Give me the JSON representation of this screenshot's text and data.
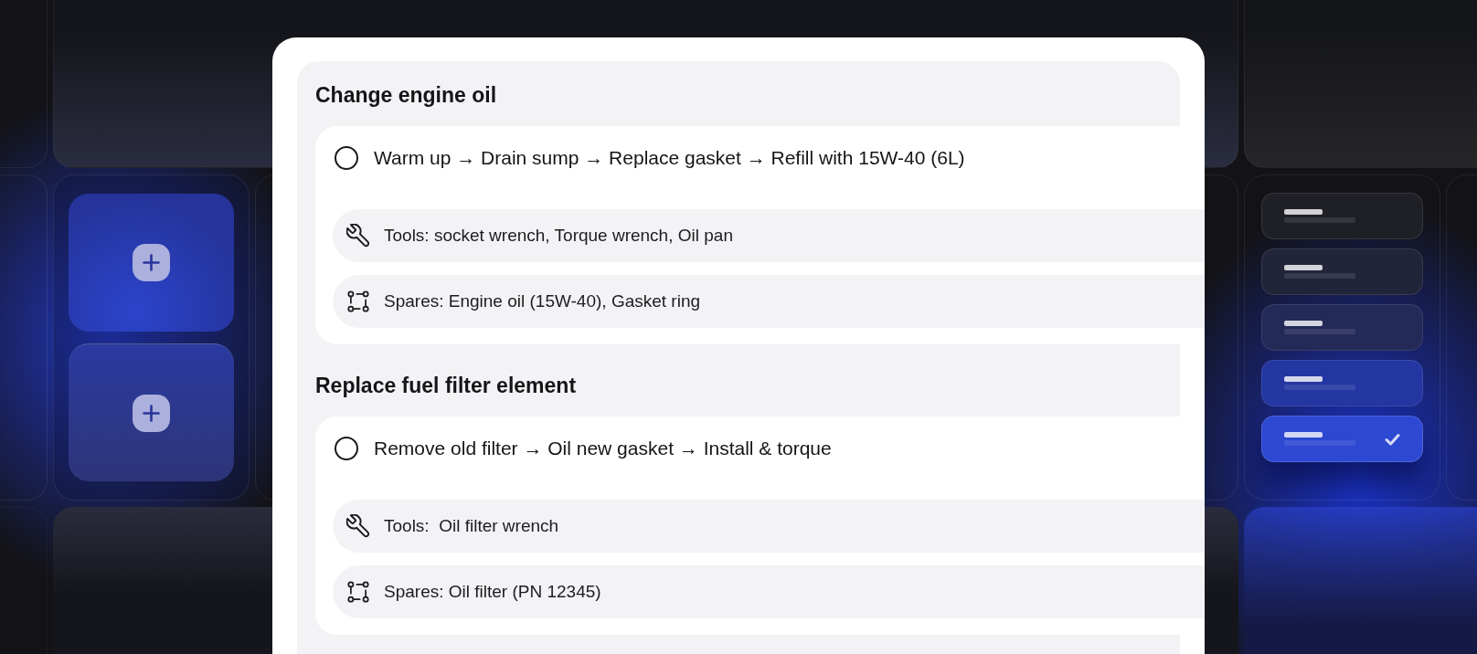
{
  "tasks": [
    {
      "title": "Change engine oil",
      "step": {
        "text": "Warm up → Drain sump → Replace gasket → Refill with 15W-40 (6L)",
        "checked": false
      },
      "details": [
        {
          "kind": "tools",
          "text": "Tools: socket wrench, Torque wrench, Oil pan"
        },
        {
          "kind": "spares",
          "text": "Spares: Engine oil (15W-40), Gasket ring"
        }
      ]
    },
    {
      "title": "Replace fuel filter element",
      "step": {
        "text": "Remove old filter → Oil new gasket → Install & torque",
        "checked": false
      },
      "details": [
        {
          "kind": "tools",
          "text": "Tools:  Oil filter wrench"
        },
        {
          "kind": "spares",
          "text": "Spares: Oil filter (PN 12345)"
        }
      ]
    }
  ],
  "option_list": [
    {
      "selected": false
    },
    {
      "selected": false
    },
    {
      "selected": false
    },
    {
      "selected": false
    },
    {
      "selected": true
    }
  ]
}
